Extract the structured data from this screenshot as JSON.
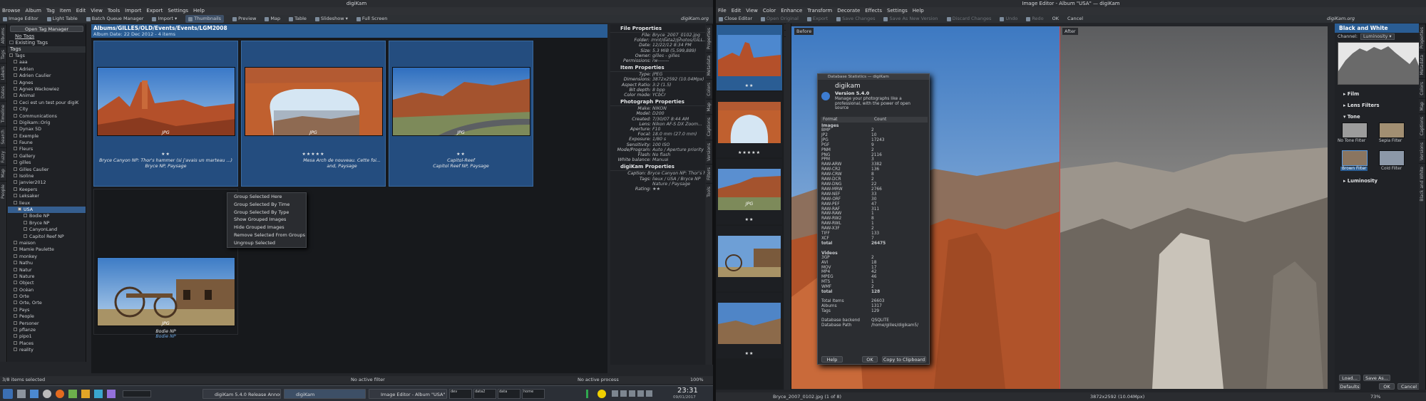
{
  "left_window": {
    "title": "digiKam",
    "menu": [
      "Browse",
      "Album",
      "Tag",
      "Item",
      "Edit",
      "View",
      "Tools",
      "Import",
      "Export",
      "Settings",
      "Help"
    ],
    "toolbar": [
      "Image Editor",
      "Light Table",
      "Batch Queue Manager",
      "Import",
      "Thumbnails",
      "Preview",
      "Map",
      "Table",
      "Slideshow",
      "Full Screen"
    ],
    "brand": "digiKam.org",
    "left_tabs": [
      "Albums",
      "Tags",
      "Labels",
      "Dates",
      "Timeline",
      "Search",
      "Fuzzy",
      "Map",
      "People"
    ],
    "tag_panel": {
      "open_tag_manager": "Open Tag Manager",
      "no_tags": "No Tags",
      "existing_tags": "Existing Tags",
      "header": "Tags",
      "items": [
        "Tags",
        "aaa",
        "Adrien",
        "Adrien Caulier",
        "Agnes",
        "Agnes Wackowiez",
        "Animal",
        "Ceci est un test pour digiK",
        "City",
        "Communications",
        "Digikam::Orig",
        "Dynax 5D",
        "Exemple",
        "Faune",
        "Fleurs",
        "Gallery",
        "gilles",
        "Gilles Caulier",
        "Isoline",
        "janvier2012",
        "Keepers",
        "Leksaker",
        "lieux",
        "USA",
        "Bodie NP",
        "Bryce NP",
        "CanyonLand",
        "Capitol Reef NP",
        "maison",
        "Mamie Paulette",
        "monkey",
        "Nathu",
        "Natur",
        "Nature",
        "Object",
        "Océan",
        "Orte",
        "Orte, Orte",
        "Pays",
        "People",
        "Personer",
        "pflanze",
        "pipo1",
        "Places",
        "reality"
      ],
      "selected": "USA"
    },
    "album": {
      "path": "Albums/GILLES/OLD/Events/Events/LGM2008",
      "subtitle": "Album Date: 22 Dec 2012 - 4 items",
      "items": [
        {
          "format": "JPG",
          "stars": "★★",
          "caption1": "Bryce Canyon NP:  Thor's hammer (si j'avais un marteau ...)",
          "caption2": "Bryce NP, Paysage"
        },
        {
          "format": "JPG",
          "stars": "★★★★★",
          "caption1": "Mesa Arch de nouveau. Cette foi...",
          "caption2": "and, Paysage"
        },
        {
          "format": "JPG",
          "stars": "★★",
          "caption1": "Capitol-Reef",
          "caption2": "Capitol Reef NP, Paysage"
        },
        {
          "format": "JPG",
          "stars": "",
          "caption1": "Bodie NP",
          "caption2": "Bodie NP"
        }
      ]
    },
    "context_menu": [
      "Group Selected Here",
      "Group Selected By Time",
      "Group Selected By Type",
      "Show Grouped Images",
      "Hide Grouped Images",
      "Remove Selected From Groups",
      "Ungroup Selected"
    ],
    "properties": {
      "file_header": "File Properties",
      "file": [
        [
          "File:",
          "Bryce_2007_0102.jpg"
        ],
        [
          "Folder:",
          "/mnt/data2/photos/GILL..."
        ],
        [
          "Date:",
          "12/22/12 8:34 PM"
        ],
        [
          "Size:",
          "5.3 MiB (5,599,889)"
        ],
        [
          "Owner:",
          "gilles - gilles"
        ],
        [
          "Permissions:",
          "rw-------"
        ]
      ],
      "item_header": "Item Properties",
      "item": [
        [
          "Type:",
          "JPEG"
        ],
        [
          "Dimensions:",
          "3872x2592 (10.04Mpx)"
        ],
        [
          "Aspect Ratio:",
          "3:2 (1.5)"
        ],
        [
          "Bit depth:",
          "8 bpp"
        ],
        [
          "Color mode:",
          "YCbCr"
        ]
      ],
      "photo_header": "Photograph Properties",
      "photo": [
        [
          "Make:",
          "NIKON"
        ],
        [
          "Model:",
          "D200"
        ],
        [
          "Created:",
          "7/30/07 8:44 AM"
        ],
        [
          "Lens:",
          "Nikon AF-S DX Zoom..."
        ],
        [
          "Aperture:",
          "F10"
        ],
        [
          "Focal:",
          "18.0 mm (27.0 mm)"
        ],
        [
          "Exposure:",
          "1/80 s"
        ],
        [
          "Sensitivity:",
          "100 ISO"
        ],
        [
          "Mode/Program:",
          "Auto / Aperture priority"
        ],
        [
          "Flash:",
          "No flash"
        ],
        [
          "White balance:",
          "Manual"
        ]
      ],
      "dk_header": "digiKam Properties",
      "dk": [
        [
          "Caption:",
          "Bryce Canyon NP:  Thor's ha..."
        ],
        [
          "Tags:",
          "lieux / USA / Bryce NP"
        ],
        [
          "",
          "Nature / Paysage"
        ],
        [
          "Rating:",
          "★★"
        ]
      ],
      "right_tabs": [
        "Properties",
        "Metadata",
        "Colors",
        "Map",
        "Captions",
        "Versions",
        "Filters",
        "Tools"
      ]
    },
    "status": {
      "left": "3/8 items selected",
      "mid": "No active filter",
      "right": "No active process",
      "zoom": "100%"
    },
    "taskbar": {
      "tasks": [
        "digiKam 5.4.0 Release Annou...",
        "digiKam",
        "Image Editor - Album \"USA\" ..."
      ],
      "desktops": [
        "dev",
        "data2",
        "data",
        "home"
      ],
      "time": "23:31",
      "date": "09/01/2017"
    }
  },
  "right_window": {
    "title": "Image Editor - Album \"USA\" — digiKam",
    "menu": [
      "File",
      "Edit",
      "View",
      "Color",
      "Enhance",
      "Transform",
      "Decorate",
      "Effects",
      "Settings",
      "Help"
    ],
    "toolbar": [
      "Close Editor",
      "Open Original",
      "Export",
      "Save Changes",
      "Save As New Version",
      "Discard Changes",
      "Undo",
      "Redo",
      "OK",
      "Cancel"
    ],
    "brand": "digiKam.org",
    "strip_stars": [
      "★★",
      "★★★★★",
      "★★",
      "★★",
      "★★"
    ],
    "strip_formats": [
      "",
      "",
      "JPG",
      "",
      ""
    ],
    "before_label": "Before",
    "after_label": "After",
    "status_left": "Bryce_2007_0102.jpg (1 of 8)",
    "status_right": "3872x2592 (10.04Mpx)",
    "zoom": "73%",
    "dialog": {
      "title": "Database Statistics — digiKam",
      "app": "digikam",
      "version": "Version 5.4.0",
      "desc": "Manage your photographs like a professional, with the power of open source",
      "col_format": "Format",
      "col_count": "Count",
      "images_label": "Images",
      "images": [
        [
          "BMP",
          "2"
        ],
        [
          "JP2",
          "10"
        ],
        [
          "JPG",
          "17243"
        ],
        [
          "PGF",
          "9"
        ],
        [
          "PNM",
          "2"
        ],
        [
          "PNG",
          "2116"
        ],
        [
          "PPM",
          "3"
        ],
        [
          "RAW-ARW",
          "3382"
        ],
        [
          "RAW-CR2",
          "136"
        ],
        [
          "RAW-CRW",
          "8"
        ],
        [
          "RAW-DCR",
          "2"
        ],
        [
          "RAW-DNG",
          "22"
        ],
        [
          "RAW-MRW",
          "2766"
        ],
        [
          "RAW-NEF",
          "33"
        ],
        [
          "RAW-ORF",
          "30"
        ],
        [
          "RAW-PEF",
          "47"
        ],
        [
          "RAW-RAF",
          "311"
        ],
        [
          "RAW-RAW",
          "1"
        ],
        [
          "RAW-RW2",
          "8"
        ],
        [
          "RAW-RWL",
          "1"
        ],
        [
          "RAW-X3F",
          "2"
        ],
        [
          "TIFF",
          "133"
        ],
        [
          "XCF",
          "7"
        ]
      ],
      "images_total": [
        "total",
        "26475"
      ],
      "videos_label": "Videos",
      "videos": [
        [
          "3GP",
          "2"
        ],
        [
          "AVI",
          "18"
        ],
        [
          "MOV",
          "17"
        ],
        [
          "MP4",
          "42"
        ],
        [
          "MPEG",
          "46"
        ],
        [
          "MTS",
          "1"
        ],
        [
          "WMF",
          "2"
        ]
      ],
      "videos_total": [
        "total",
        "128"
      ],
      "summary": [
        [
          "Total Items",
          "26603"
        ],
        [
          "Albums",
          "1317"
        ],
        [
          "Tags",
          "129"
        ]
      ],
      "db": [
        [
          "Database backend",
          "QSQLITE"
        ],
        [
          "Database Path",
          "/home/gilles/digikam5/"
        ]
      ],
      "buttons": [
        "Help",
        "OK",
        "Copy to Clipboard"
      ]
    },
    "bw_panel": {
      "title": "Black and White",
      "channel_label": "Channel:",
      "channel_value": "Luminosity",
      "sections": [
        "Film",
        "Lens Filters",
        "Tone",
        "Luminosity"
      ],
      "filters": [
        "No Tone Filter",
        "Sepia Filter",
        "Brown Filter",
        "Cold Filter"
      ],
      "buttons": [
        "Load...",
        "Save As...",
        "Defaults",
        "OK",
        "Cancel"
      ],
      "right_tabs": [
        "Properties",
        "Metadata",
        "Colors",
        "Map",
        "Captions",
        "Versions",
        "Black and White"
      ]
    }
  }
}
